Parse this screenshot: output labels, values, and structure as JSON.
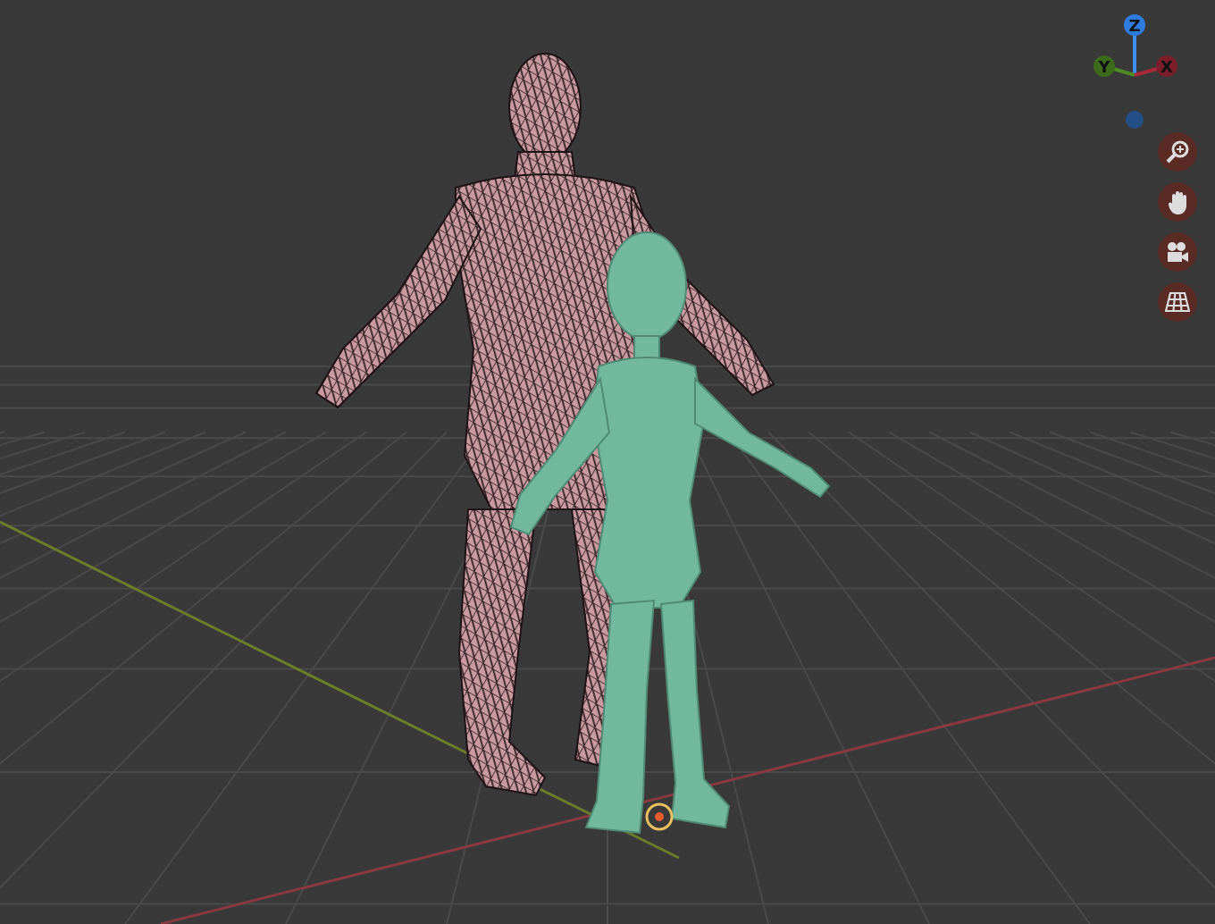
{
  "viewport": {
    "gizmo": {
      "axes": [
        {
          "label": "Z",
          "kind": "z"
        },
        {
          "label": "Y",
          "kind": "y"
        },
        {
          "label": "X",
          "kind": "x"
        }
      ]
    },
    "tools": [
      {
        "kind": "zoom"
      },
      {
        "kind": "pan"
      },
      {
        "kind": "camera"
      },
      {
        "kind": "grid"
      }
    ]
  }
}
